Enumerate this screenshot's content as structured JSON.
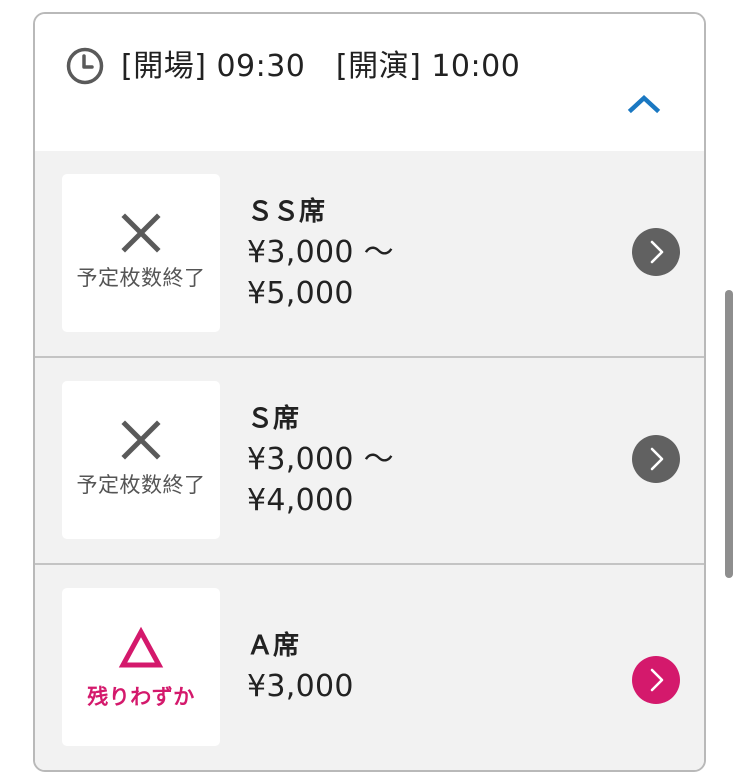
{
  "header": {
    "schedule_text": "[開場] 09:30　[開演] 10:00",
    "clock_icon": "clock-icon",
    "collapse_icon": "chevron-up-icon",
    "accent_color": "#1a78c2"
  },
  "seats": [
    {
      "status_label": "予定枚数終了",
      "status_icon": "cross-icon",
      "name": "ＳＳ席",
      "price_line_1": "¥3,000 〜",
      "price_line_2": "¥5,000",
      "arrow_icon": "chevron-right-icon",
      "arrow_color": "#616161"
    },
    {
      "status_label": "予定枚数終了",
      "status_icon": "cross-icon",
      "name": "Ｓ席",
      "price_line_1": "¥3,000 〜",
      "price_line_2": "¥4,000",
      "arrow_icon": "chevron-right-icon",
      "arrow_color": "#616161"
    },
    {
      "status_label": "残りわずか",
      "status_icon": "triangle-icon",
      "name": "Ａ席",
      "price_line_1": "¥3,000",
      "arrow_icon": "chevron-right-icon",
      "arrow_color": "#d4196c"
    }
  ],
  "colors": {
    "sold_out_gray": "#555555",
    "few_left_pink": "#d4196c",
    "row_background": "#f2f2f2"
  }
}
